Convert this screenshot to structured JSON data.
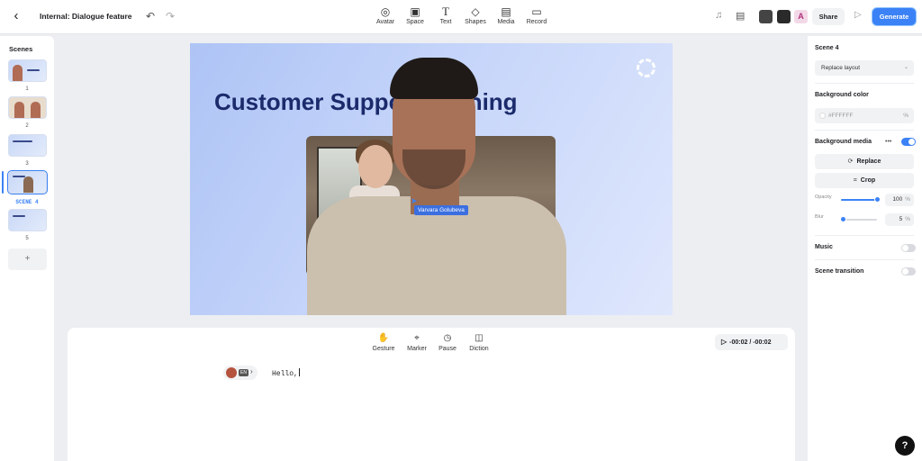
{
  "header": {
    "title": "Internal: Dialogue feature",
    "tools": [
      {
        "label": "Avatar",
        "icon": "avatar-icon"
      },
      {
        "label": "Space",
        "icon": "space-icon"
      },
      {
        "label": "Text",
        "icon": "text-icon"
      },
      {
        "label": "Shapes",
        "icon": "shapes-icon"
      },
      {
        "label": "Media",
        "icon": "media-icon"
      },
      {
        "label": "Record",
        "icon": "record-icon"
      }
    ],
    "share_label": "Share",
    "generate_label": "Generate",
    "collaborator_badge": "A"
  },
  "scenes": {
    "title": "Scenes",
    "items": [
      {
        "number": "1"
      },
      {
        "number": "2"
      },
      {
        "number": "3"
      },
      {
        "number": "SCENE 4",
        "active": true
      },
      {
        "number": "5"
      }
    ],
    "add_label": "+"
  },
  "canvas": {
    "title": "Customer Support Training",
    "collaborator_cursor": "Varvara Golubeva"
  },
  "script": {
    "tools": [
      {
        "label": "Gesture",
        "icon": "gesture-icon"
      },
      {
        "label": "Marker",
        "icon": "marker-icon"
      },
      {
        "label": "Pause",
        "icon": "pause-icon"
      },
      {
        "label": "Diction",
        "icon": "diction-icon"
      }
    ],
    "timer": "-00:02 / -00:02",
    "language": "EN",
    "text": "Hello,"
  },
  "properties": {
    "scene_label": "Scene 4",
    "layout_value": "Replace layout",
    "bg_color_label": "Background color",
    "bg_color_value": "#FFFFFF",
    "bg_color_unit": "%",
    "bg_media_label": "Background media",
    "bg_media_enabled": true,
    "replace_label": "Replace",
    "crop_label": "Crop",
    "opacity_label": "Opacity",
    "opacity_value": "100",
    "blur_label": "Blur",
    "blur_value": "5",
    "unit": "%",
    "music_label": "Music",
    "music_enabled": false,
    "transition_label": "Scene transition",
    "transition_enabled": false
  },
  "help_label": "?",
  "colors": {
    "accent": "#3b82f6",
    "title_navy": "#1b2a6b"
  }
}
